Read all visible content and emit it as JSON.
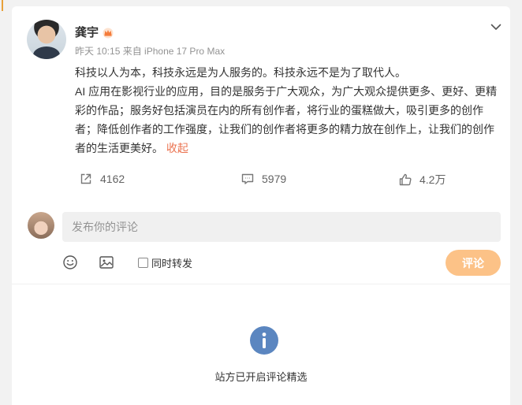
{
  "post": {
    "author": "龚宇",
    "timestamp": "昨天 10:15",
    "source": "来自 iPhone 17 Pro Max",
    "paragraphs": [
      "科技以人为本，科技永远是为人服务的。科技永远不是为了取代人。",
      "AI 应用在影视行业的应用，目的是服务于广大观众，为广大观众提供更多、更好、更精彩的作品；服务好包括演员在内的所有创作者，将行业的蛋糕做大，吸引更多的创作者；降低创作者的工作强度，让我们的创作者将更多的精力放在创作上，让我们的创作者的生活更美好。"
    ],
    "collapse_label": "收起"
  },
  "actions": {
    "repost_count": "4162",
    "comment_count": "5979",
    "like_count": "4.2万"
  },
  "composer": {
    "placeholder": "发布你的评论",
    "repost_label": "同时转发",
    "submit_label": "评论"
  },
  "notice": {
    "curated": "站方已开启评论精选"
  },
  "icons": {
    "verified_badge": "crown-icon",
    "menu": "chevron-down-icon",
    "repost": "share-icon",
    "comment": "comment-icon",
    "like": "thumbs-up-icon",
    "emoji": "emoji-icon",
    "image": "image-icon",
    "info": "info-icon"
  },
  "colors": {
    "accent": "#eb7350",
    "submit_button": "#fcc287",
    "info_icon": "#5b86c0"
  }
}
